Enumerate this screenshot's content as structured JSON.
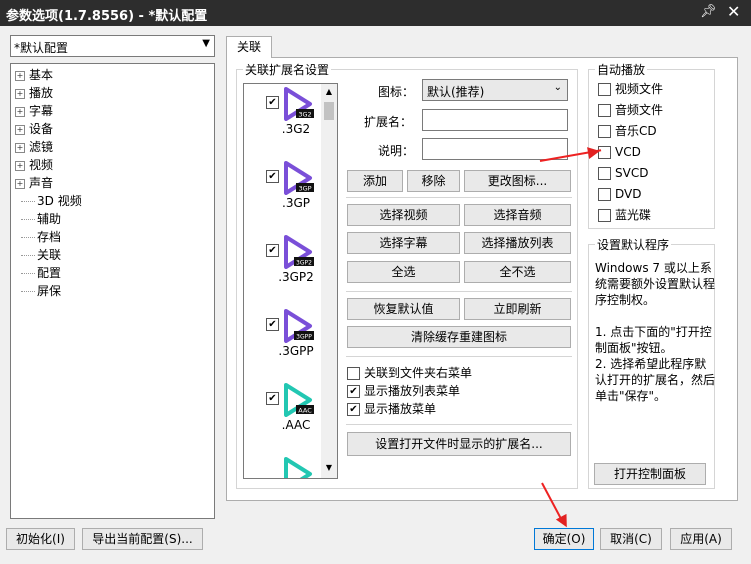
{
  "window": {
    "title": "参数选项(1.7.8556) - *默认配置",
    "pin_icon": "pin-icon",
    "close_glyph": "✕"
  },
  "profile": {
    "selected": "*默认配置"
  },
  "tree": {
    "items": [
      "基本",
      "播放",
      "字幕",
      "设备",
      "滤镜",
      "视频",
      "声音",
      "3D 视频",
      "辅助",
      "存档",
      "关联",
      "配置",
      "屏保"
    ]
  },
  "tab": {
    "label": "关联"
  },
  "assoc": {
    "title": "关联扩展名设置",
    "ext_list": [
      {
        "name": ".3G2",
        "tag": "3G2",
        "checked": true,
        "color": "#7a4fd8"
      },
      {
        "name": ".3GP",
        "tag": "3GP",
        "checked": true,
        "color": "#7a4fd8"
      },
      {
        "name": ".3GP2",
        "tag": "3GP2",
        "checked": true,
        "color": "#7a4fd8"
      },
      {
        "name": ".3GPP",
        "tag": "3GPP",
        "checked": true,
        "color": "#7a4fd8"
      },
      {
        "name": ".AAC",
        "tag": "AAC",
        "checked": true,
        "color": "#22c7b2"
      },
      {
        "name": "",
        "tag": "",
        "checked": false,
        "color": "#22c7b2"
      }
    ],
    "icon_label": "图标：",
    "icon_value": "默认(推荐)",
    "ext_label": "扩展名：",
    "desc_label": "说明：",
    "buttons": {
      "add": "添加",
      "remove": "移除",
      "change_icon": "更改图标...",
      "select_video": "选择视频",
      "select_audio": "选择音频",
      "select_subtitle": "选择字幕",
      "select_playlist": "选择播放列表",
      "select_all": "全选",
      "select_none": "全不选",
      "restore_default": "恢复默认值",
      "refresh_now": "立即刷新",
      "clear_cache": "清除缓存重建图标",
      "set_open_ext": "设置打开文件时显示的扩展名..."
    },
    "options": [
      {
        "label": "关联到文件夹右菜单",
        "checked": false
      },
      {
        "label": "显示播放列表菜单",
        "checked": true
      },
      {
        "label": "显示播放菜单",
        "checked": true
      }
    ]
  },
  "autoplay": {
    "title": "自动播放",
    "items": [
      {
        "label": "视频文件",
        "checked": false
      },
      {
        "label": "音频文件",
        "checked": false
      },
      {
        "label": "音乐CD",
        "checked": false
      },
      {
        "label": "VCD",
        "checked": false
      },
      {
        "label": "SVCD",
        "checked": false
      },
      {
        "label": "DVD",
        "checked": false
      },
      {
        "label": "蓝光碟",
        "checked": false
      }
    ]
  },
  "default_program": {
    "title": "设置默认程序",
    "text": "Windows 7 或以上系统需要额外设置默认程序控制权。\n\n1. 点击下面的\"打开控制面板\"按钮。\n2. 选择希望此程序默认打开的扩展名，然后单击\"保存\"。",
    "button": "打开控制面板"
  },
  "footer": {
    "init": "初始化(I)",
    "export": "导出当前配置(S)...",
    "ok": "确定(O)",
    "cancel": "取消(C)",
    "apply": "应用(A)"
  },
  "colors": {
    "annotation_arrow": "#e22222",
    "titlebar": "#2d2d2d"
  }
}
